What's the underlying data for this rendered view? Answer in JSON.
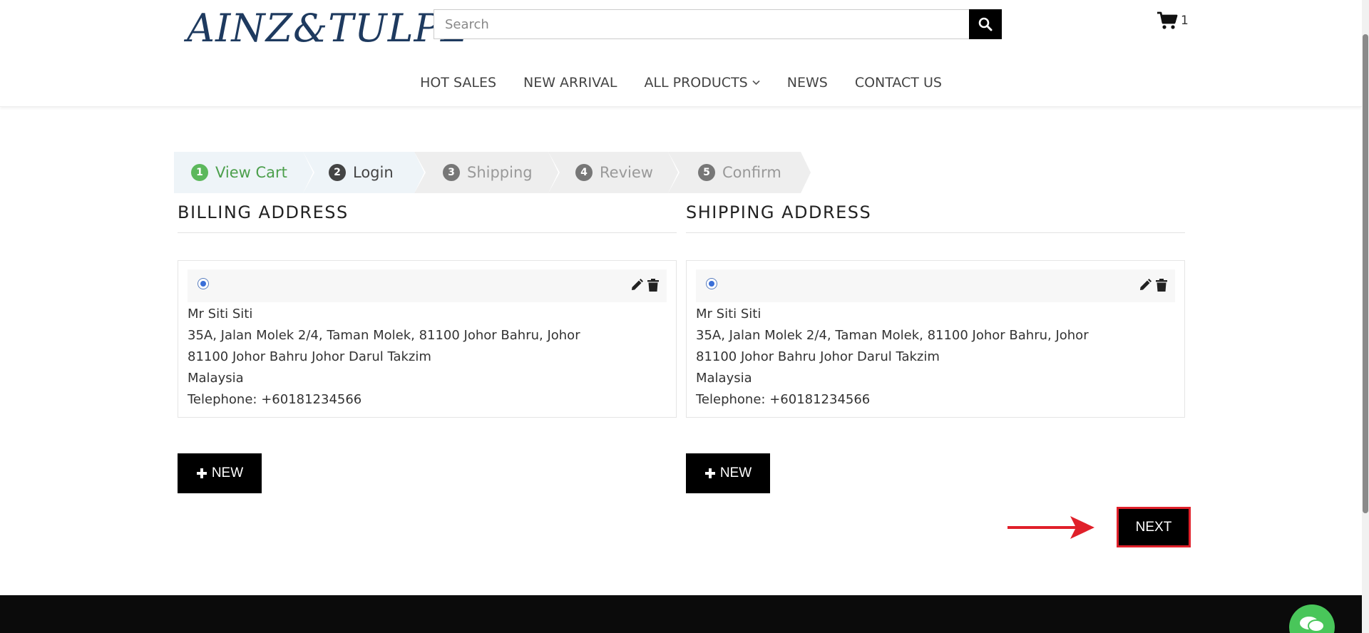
{
  "header": {
    "logo_text": "AINZ&TULPE",
    "search_placeholder": "Search",
    "cart_count": "1"
  },
  "nav": {
    "items": [
      "HOT SALES",
      "NEW ARRIVAL",
      "ALL PRODUCTS",
      "NEWS",
      "CONTACT US"
    ]
  },
  "steps": [
    {
      "num": "1",
      "label": "View Cart"
    },
    {
      "num": "2",
      "label": "Login"
    },
    {
      "num": "3",
      "label": "Shipping"
    },
    {
      "num": "4",
      "label": "Review"
    },
    {
      "num": "5",
      "label": "Confirm"
    }
  ],
  "billing": {
    "title": "BILLING ADDRESS",
    "name": "Mr Siti Siti",
    "line1": "35A, Jalan Molek 2/4, Taman Molek, 81100 Johor Bahru, Johor",
    "line2": "81100 Johor Bahru Johor Darul Takzim",
    "country": "Malaysia",
    "phone": "Telephone: +60181234566",
    "new_label": "NEW"
  },
  "shipping": {
    "title": "SHIPPING ADDRESS",
    "name": "Mr Siti Siti",
    "line1": "35A, Jalan Molek 2/4, Taman Molek, 81100 Johor Bahru, Johor",
    "line2": "81100 Johor Bahru Johor Darul Takzim",
    "country": "Malaysia",
    "phone": "Telephone: +60181234566",
    "new_label": "NEW"
  },
  "next_label": "NEXT",
  "colors": {
    "step_done": "#5cb85c",
    "highlight": "#e0202a",
    "chat": "#49c65a"
  }
}
